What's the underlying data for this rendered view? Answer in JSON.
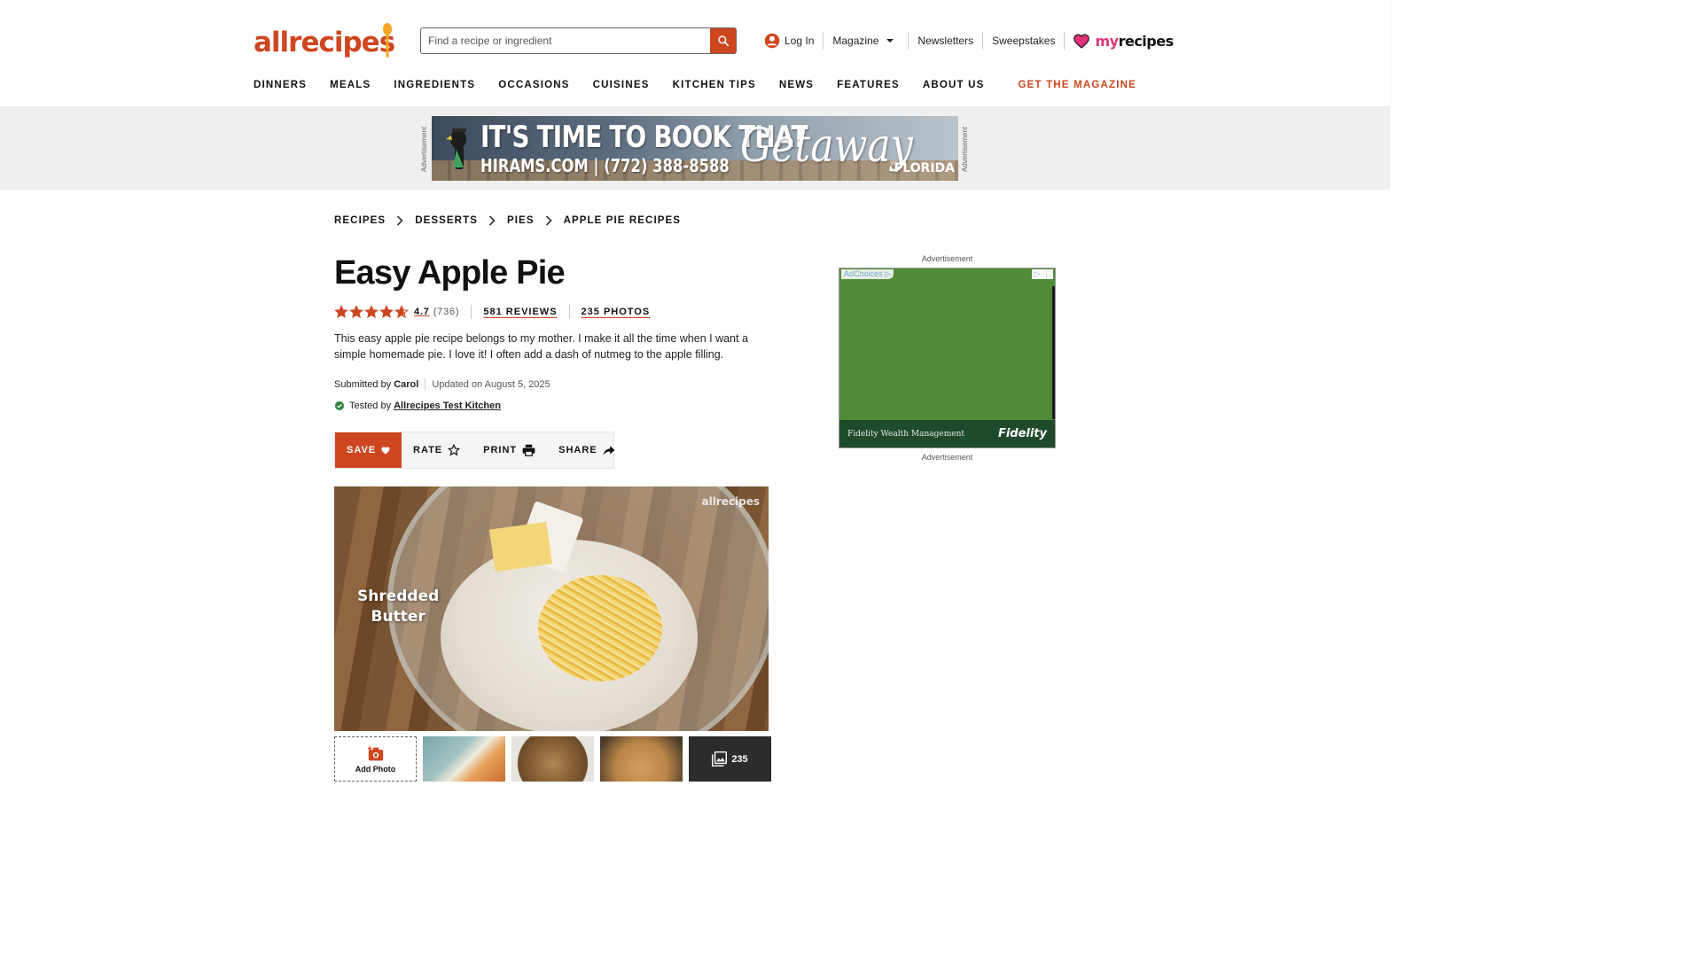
{
  "header": {
    "logo_text": "allrecipes",
    "search_placeholder": "Find a recipe or ingredient",
    "login": "Log In",
    "magazine": "Magazine",
    "newsletters": "Newsletters",
    "sweepstakes": "Sweepstakes",
    "myrecipes_my": "my",
    "myrecipes_rest": "recipes"
  },
  "nav": {
    "items": [
      "DINNERS",
      "MEALS",
      "INGREDIENTS",
      "OCCASIONS",
      "CUISINES",
      "KITCHEN TIPS",
      "NEWS",
      "FEATURES",
      "ABOUT US"
    ],
    "cta": "GET THE MAGAZINE"
  },
  "banner_ad": {
    "label": "Advertisement",
    "headline": "IT'S TIME TO BOOK THAT",
    "subline": "HIRAMS.COM | (772) 388-8588",
    "script": "Getaway",
    "visit": "VISIT",
    "florida": "FLORIDA"
  },
  "breadcrumb": [
    "RECIPES",
    "DESSERTS",
    "PIES",
    "APPLE PIE RECIPES"
  ],
  "recipe": {
    "title": "Easy Apple Pie",
    "rating": "4.7",
    "rating_stars": 4.7,
    "rating_count": "(736)",
    "reviews": "581 REVIEWS",
    "photos": "235 PHOTOS",
    "description": "This easy apple pie recipe belongs to my mother. I make it all the time when I want a simple homemade pie. I love it! I often add a dash of nutmeg to the apple filling.",
    "submitted_label": "Submitted by",
    "author": "Carol",
    "updated": "Updated on August 5, 2025",
    "tested_label": "Tested by",
    "tested_by": "Allrecipes Test Kitchen"
  },
  "actions": {
    "save": "SAVE",
    "rate": "RATE",
    "print": "PRINT",
    "share": "SHARE"
  },
  "video": {
    "caption_line1": "Shredded",
    "caption_line2": "Butter",
    "watermark": "allrecipes"
  },
  "thumbs": {
    "add_photo": "Add Photo",
    "more_count": "235"
  },
  "side_ad": {
    "label_top": "Advertisement",
    "label_bottom": "Advertisement",
    "adchoices": "AdChoices",
    "sponsor": "Fidelity Wealth Management",
    "brand": "Fidelity"
  },
  "colors": {
    "brand": "#ce4620",
    "myrecipes_pink": "#e0337a",
    "ad_green": "#4e8a37"
  }
}
